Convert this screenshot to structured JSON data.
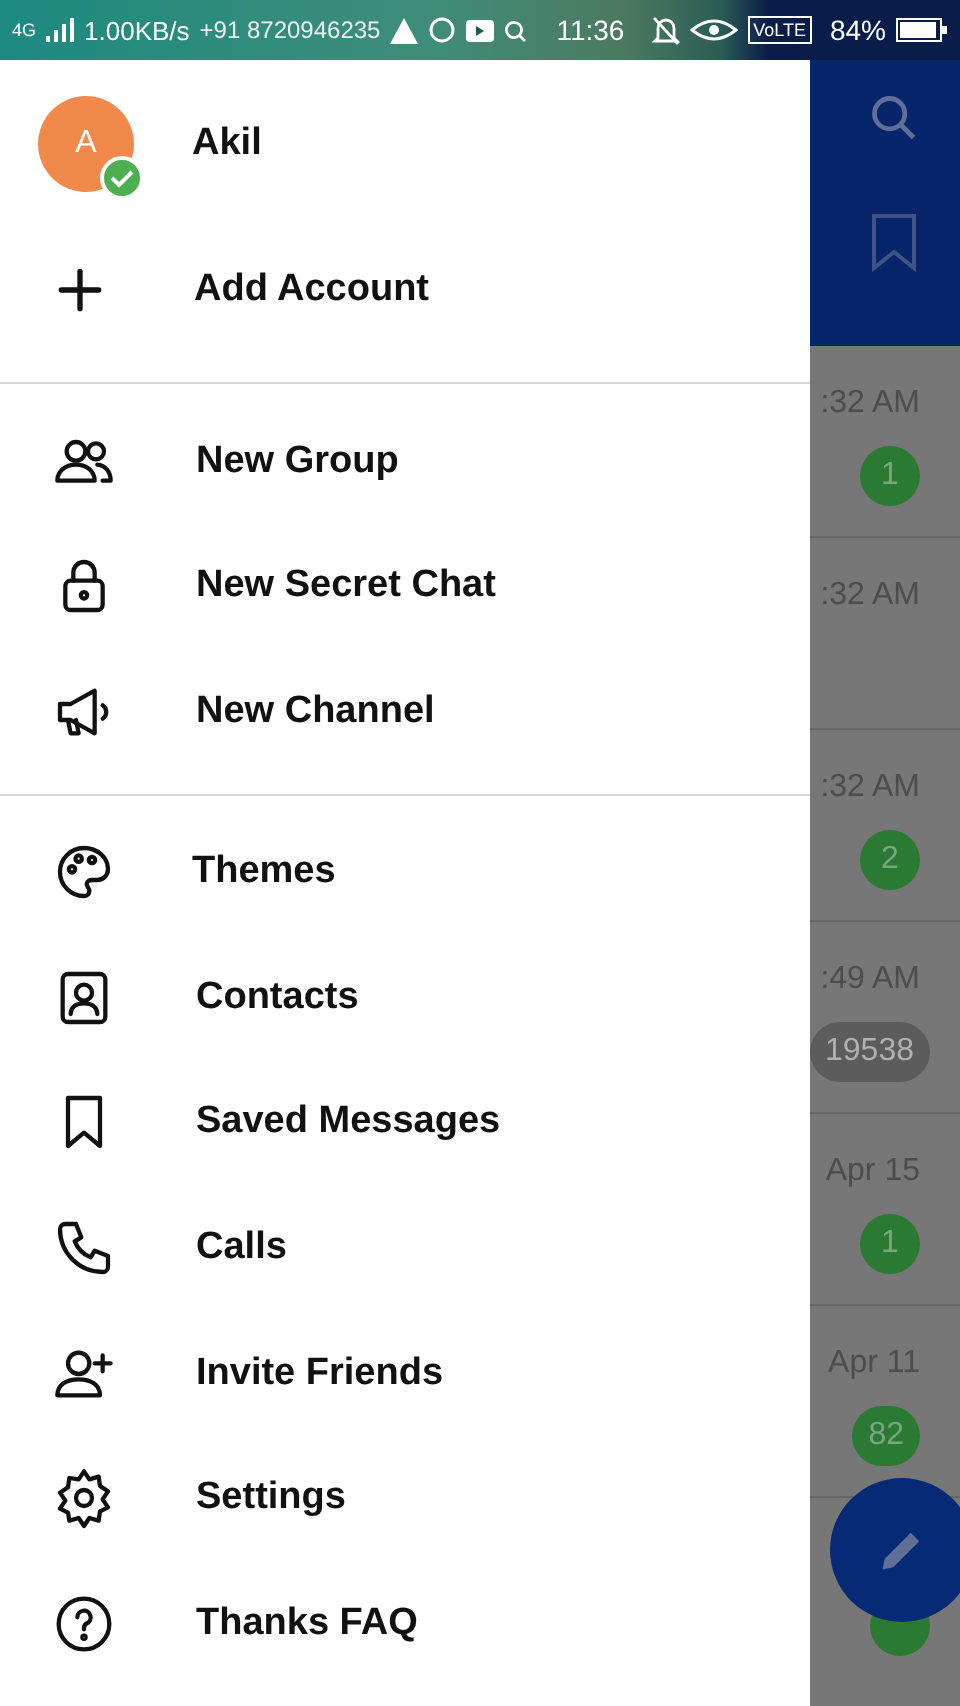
{
  "status_bar": {
    "network": "4G",
    "speed": "1.00KB/s",
    "notification": "+91 8720946235",
    "time": "11:36",
    "volte": "VoLTE",
    "battery": "84%"
  },
  "drawer": {
    "account": {
      "initial": "A",
      "name": "Akil",
      "verified": true
    },
    "add_account": "Add Account",
    "sections": [
      {
        "items": [
          {
            "kind": "group",
            "label": "New Group"
          },
          {
            "kind": "lock",
            "label": "New Secret Chat"
          },
          {
            "kind": "megaphone",
            "label": "New Channel"
          }
        ]
      },
      {
        "items": [
          {
            "kind": "palette",
            "label": "Themes"
          },
          {
            "kind": "contact",
            "label": "Contacts"
          },
          {
            "kind": "bookmark",
            "label": "Saved Messages"
          },
          {
            "kind": "phone",
            "label": "Calls"
          },
          {
            "kind": "invite",
            "label": "Invite Friends"
          },
          {
            "kind": "gear",
            "label": "Settings"
          },
          {
            "kind": "help",
            "label": "Thanks FAQ"
          }
        ]
      }
    ]
  },
  "chat_list": {
    "rows": [
      {
        "time": ":32 AM",
        "badge": "1",
        "muted": false
      },
      {
        "time": ":32 AM"
      },
      {
        "time": ":32 AM",
        "badge": "2",
        "muted": false
      },
      {
        "time": ":49 AM",
        "badge": "19538",
        "muted": true
      },
      {
        "time": "Apr 15",
        "badge": "1",
        "muted": false
      },
      {
        "time": "Apr 11",
        "badge": "82",
        "muted": false
      }
    ]
  }
}
